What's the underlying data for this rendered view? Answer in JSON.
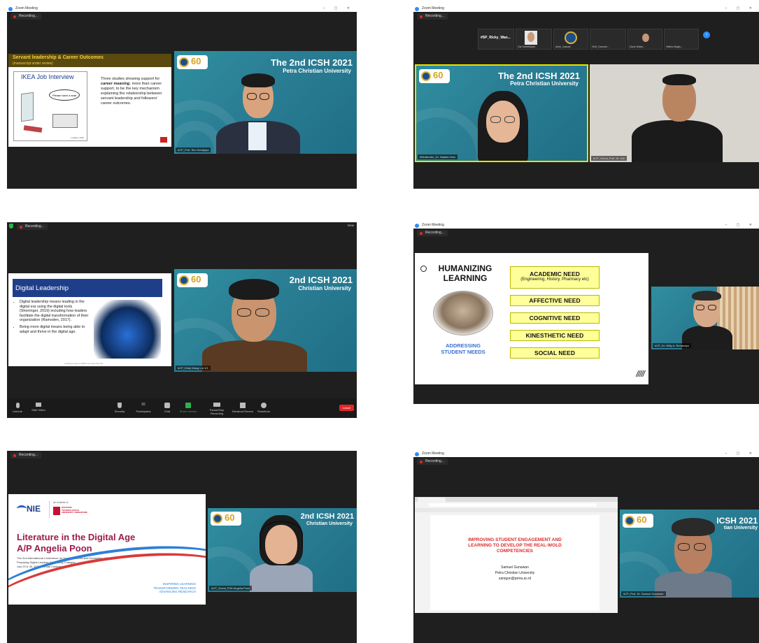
{
  "window_title": "Zoom Meeting",
  "recording_label": "Recording...",
  "conference": {
    "title": "The 2nd ICSH 2021",
    "university": "Petra Christian University",
    "title_partial": "2nd ICSH 2021",
    "university_partial": "Christian University",
    "title_partial2": "ICSH 2021",
    "university_partial2": "tian University",
    "logo_number": "60"
  },
  "colors": {
    "zoom_blue": "#2d8cff",
    "record_red": "#e02828",
    "slide_yellow": "#ffff99",
    "conf_teal": "#2b7f95",
    "title_red": "#e02828"
  },
  "s1": {
    "slide_title": "Servant leadership & Career Outcomes",
    "slide_subtitle": "(manuscript under review)",
    "inset_title": "IKEA Job Interview",
    "bubble": "Please have a seat",
    "caption": "Leadley, 2010",
    "body_pre": "Three studies showing support for ",
    "body_em": "career meaning",
    "body_post": ", more than career support, to be the key mechanism explaining the relationship between servant leadership and followers' career outcomes.",
    "speaker_label": "#CP_Prof. Sen Sendjaya"
  },
  "s2": {
    "thumbs": [
      {
        "name": "#SP_Ricky_Wan...",
        "label": "#SP_Ricky_Wan..."
      },
      {
        "name": "Gar Karthikeyan"
      },
      {
        "name": "Ahok_Josuaw"
      },
      {
        "name": "HUK_Danand..."
      },
      {
        "name": "Dana Wulan..."
      },
      {
        "name": "Halibur Bagis..."
      }
    ],
    "moderator_label": "#Moderator_Dr. Natalia Ham",
    "speaker_label": "#CP_Guest_Prof. Dr. Ndi"
  },
  "s3": {
    "slide_title": "Digital Leadership",
    "bullets": [
      "Digital leadership means leading in the digital era using the digital tools  (Sheninger, 2019) including how leaders facilitate the digital transformation of their organization (Ramsden, 2017).",
      "Being more digital means being able to adapt and thrive in the digital age."
    ],
    "footer": "Leading Learners Within the New Normal",
    "speaker_label": "#CP_Eddy Mang Lut 1/1",
    "view_label": "View",
    "toolbar": [
      "Unmute",
      "Start Video",
      "Security",
      "Participants",
      "Chat",
      "Share Screen",
      "Pause/Stop Recording",
      "Breakout Rooms",
      "Reactions"
    ],
    "participants_count": "92",
    "leave": "Leave"
  },
  "s4": {
    "heading": "HUMANIZING LEARNING",
    "sub": "ADDRESSING STUDENT NEEDS",
    "needs": [
      {
        "label": "ACADEMIC NEED",
        "sub": "(Engineering, History, Pharmacy etc)"
      },
      {
        "label": "AFFECTIVE NEED"
      },
      {
        "label": "COGNITIVE NEED"
      },
      {
        "label": "KINESTHETIC NEED"
      },
      {
        "label": "SOCIAL NEED"
      }
    ],
    "hatch": "/////",
    "speaker_label": "#CP_Dr. Willy A. Renandya"
  },
  "s5": {
    "institute": "An Institute of",
    "nie": "NIE",
    "ntu": "NANYANG TECHNOLOGICAL UNIVERSITY SINGAPORE",
    "title1": "Literature in the Digital Age",
    "title2": "A/P Angelia Poon",
    "conf_line1": "The 2nd International Conference on Social Sciences and Humanities (ICSH)",
    "conf_line2": "Preparing Digital Leaders: Embracing Changes",
    "conf_line3": "July 29 & 30, 2021 - Virtual Conference",
    "motto": [
      "INSPIRING LEARNING",
      "TRANSFORMING TEACHING",
      "ADVANCING RESEARCH"
    ],
    "speaker_label": "#CP_Guest_PhD Angelia Poon"
  },
  "s6": {
    "doc_title": "IMPROVING STUDENT ENGAGEMENT AND LEARNING TO DEVELOP THE REAL-WOLD COMPETENCIES",
    "author": "Samuel Gunawan",
    "affil": "Petra Christian University",
    "email": "samgun@petra.ac.id",
    "speaker_label": "#CP_Prof. Dr. Samuel Gunawan"
  }
}
